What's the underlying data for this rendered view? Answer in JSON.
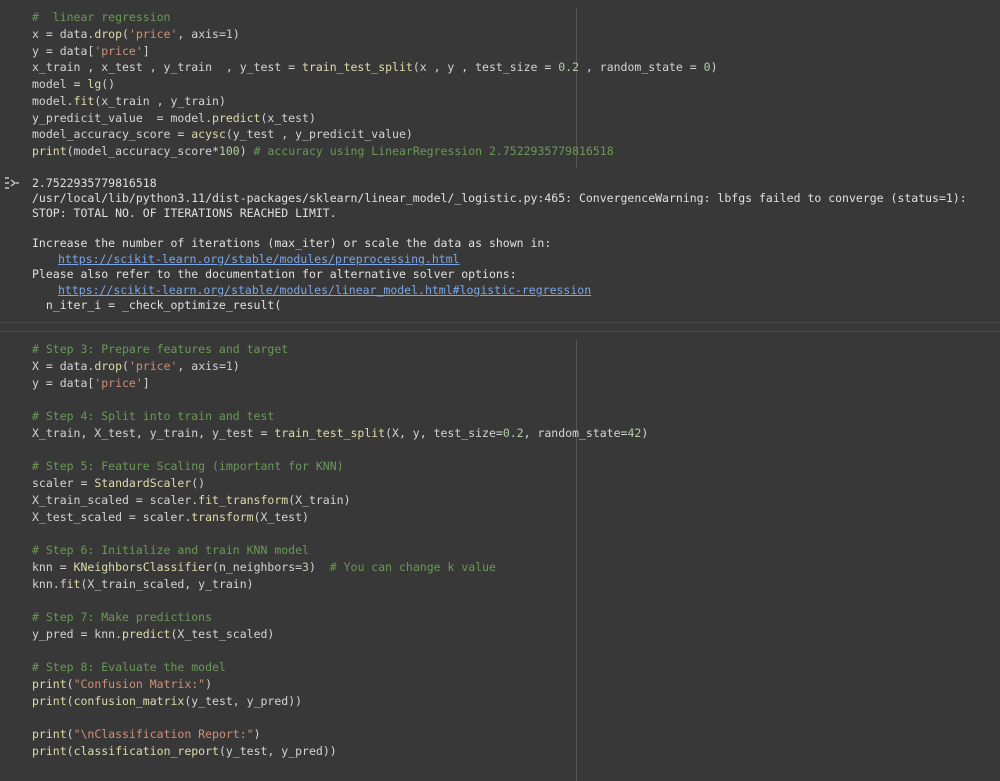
{
  "cell1": {
    "lines": [
      "#  linear regression",
      "x = data.drop('price', axis=1)",
      "y = data['price']",
      "x_train , x_test , y_train  , y_test = train_test_split(x , y , test_size = 0.2 , random_state = 0)",
      "model = lg()",
      "model.fit(x_train , y_train)",
      "y_predicit_value  = model.predict(x_test)",
      "model_accuracy_score = acysc(y_test , y_predicit_value)",
      "print(model_accuracy_score*100) # accuracy using LinearRegression 2.7522935779816518"
    ]
  },
  "output1": {
    "icon": "output-toggle-icon",
    "lines": [
      "2.7522935779816518",
      "/usr/local/lib/python3.11/dist-packages/sklearn/linear_model/_logistic.py:465: ConvergenceWarning: lbfgs failed to converge (status=1):",
      "STOP: TOTAL NO. OF ITERATIONS REACHED LIMIT.",
      "",
      "Increase the number of iterations (max_iter) or scale the data as shown in:",
      "Please also refer to the documentation for alternative solver options:",
      "  n_iter_i = _check_optimize_result("
    ],
    "link1": "https://scikit-learn.org/stable/modules/preprocessing.html",
    "link2": "https://scikit-learn.org/stable/modules/linear_model.html#logistic-regression"
  },
  "cell2": {
    "lines": [
      "# Step 3: Prepare features and target",
      "X = data.drop('price', axis=1)",
      "y = data['price']",
      "",
      "# Step 4: Split into train and test",
      "X_train, X_test, y_train, y_test = train_test_split(X, y, test_size=0.2, random_state=42)",
      "",
      "# Step 5: Feature Scaling (important for KNN)",
      "scaler = StandardScaler()",
      "X_train_scaled = scaler.fit_transform(X_train)",
      "X_test_scaled = scaler.transform(X_test)",
      "",
      "# Step 6: Initialize and train KNN model",
      "knn = KNeighborsClassifier(n_neighbors=3)  # You can change k value",
      "knn.fit(X_train_scaled, y_train)",
      "",
      "# Step 7: Make predictions",
      "y_pred = knn.predict(X_test_scaled)",
      "",
      "# Step 8: Evaluate the model",
      "print(\"Confusion Matrix:\")",
      "print(confusion_matrix(y_test, y_pred))",
      "",
      "print(\"\\nClassification Report:\")",
      "print(classification_report(y_test, y_pred))"
    ]
  }
}
